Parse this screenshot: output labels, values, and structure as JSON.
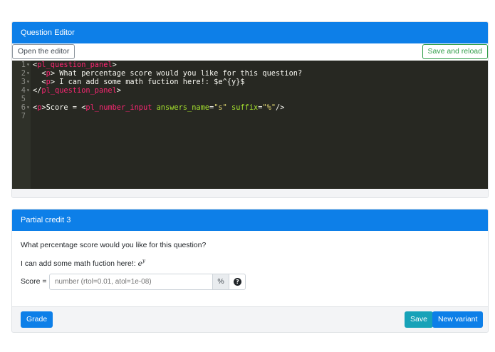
{
  "editor": {
    "header": "Question Editor",
    "open_editor_label": "Open the editor",
    "save_reload_label": "Save and reload",
    "lines": [
      {
        "num": "1",
        "fold": "▾",
        "segments": [
          {
            "cls": "t-text",
            "text": "<"
          },
          {
            "cls": "t-tag",
            "text": "pl_question_panel"
          },
          {
            "cls": "t-text",
            "text": ">"
          }
        ]
      },
      {
        "num": "2",
        "fold": "▾",
        "segments": [
          {
            "cls": "t-text",
            "text": "  <"
          },
          {
            "cls": "t-tag",
            "text": "p"
          },
          {
            "cls": "t-text",
            "text": "> What percentage score would you like for this question?"
          }
        ]
      },
      {
        "num": "3",
        "fold": "▾",
        "segments": [
          {
            "cls": "t-text",
            "text": "  <"
          },
          {
            "cls": "t-tag",
            "text": "p"
          },
          {
            "cls": "t-text",
            "text": "> I can add some math fuction here!: $e^{y}$"
          }
        ]
      },
      {
        "num": "4",
        "fold": "▾",
        "segments": [
          {
            "cls": "t-text",
            "text": "</"
          },
          {
            "cls": "t-tag",
            "text": "pl_question_panel"
          },
          {
            "cls": "t-text",
            "text": ">"
          }
        ]
      },
      {
        "num": "5",
        "fold": "",
        "segments": []
      },
      {
        "num": "6",
        "fold": "▾",
        "segments": [
          {
            "cls": "t-text",
            "text": "<"
          },
          {
            "cls": "t-tag",
            "text": "p"
          },
          {
            "cls": "t-text",
            "text": ">Score = <"
          },
          {
            "cls": "t-tag",
            "text": "pl_number_input"
          },
          {
            "cls": "t-text",
            "text": " "
          },
          {
            "cls": "t-attr",
            "text": "answers_name"
          },
          {
            "cls": "t-text",
            "text": "="
          },
          {
            "cls": "t-str",
            "text": "\"s\""
          },
          {
            "cls": "t-text",
            "text": " "
          },
          {
            "cls": "t-attr",
            "text": "suffix"
          },
          {
            "cls": "t-text",
            "text": "="
          },
          {
            "cls": "t-str",
            "text": "\"%\""
          },
          {
            "cls": "t-text",
            "text": "/>"
          }
        ]
      },
      {
        "num": "7",
        "fold": "",
        "segments": []
      }
    ]
  },
  "preview": {
    "header": "Partial credit 3",
    "question_text": "What percentage score would you like for this question?",
    "math_intro": "I can add some math fuction here!: ",
    "math_base": "e",
    "math_exponent": "y",
    "score_label": "Score =",
    "input_placeholder": "number (rtol=0.01, atol=1e-08)",
    "input_value": "",
    "suffix": "%",
    "help_glyph": "?",
    "grade_label": "Grade",
    "save_label": "Save",
    "new_variant_label": "New variant"
  },
  "colors": {
    "header_blue": "#0d7fe8",
    "save_teal": "#17a2b8",
    "save_reload_green": "#2f9d47",
    "editor_bg": "#272822"
  },
  "icons": {
    "help": "question-circle-icon",
    "fold": "fold-arrow-icon"
  }
}
